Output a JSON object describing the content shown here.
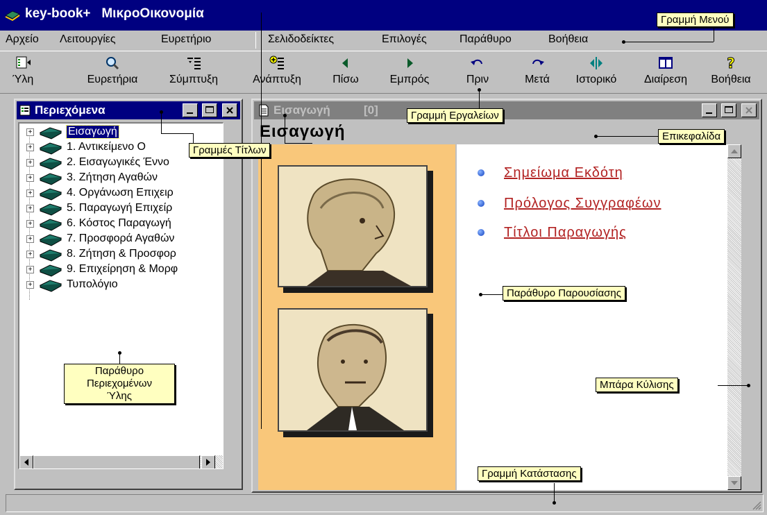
{
  "titlebar": {
    "app": "key-book+",
    "document": "ΜικροΟικονομία"
  },
  "menu": [
    "Αρχείο",
    "Λειτουργίες",
    "Ευρετήριο",
    "Σελιδοδείκτες",
    "Επιλογές",
    "Παράθυρο",
    "Βοήθεια"
  ],
  "toolbar": [
    {
      "label": "Ύλη",
      "icon": "topics-icon"
    },
    {
      "label": "Ευρετήρια",
      "icon": "search-icon"
    },
    {
      "label": "Σύμπτυξη",
      "icon": "collapse-icon"
    },
    {
      "label": "Ανάπτυξη",
      "icon": "expand-icon"
    },
    {
      "label": "Πίσω",
      "icon": "back-icon"
    },
    {
      "label": "Εμπρός",
      "icon": "forward-icon"
    },
    {
      "label": "Πριν",
      "icon": "undo-icon"
    },
    {
      "label": "Μετά",
      "icon": "redo-icon"
    },
    {
      "label": "Ιστορικό",
      "icon": "history-icon"
    },
    {
      "label": "Διαίρεση",
      "icon": "split-icon"
    },
    {
      "label": "Βοήθεια",
      "icon": "help-icon"
    }
  ],
  "contents_window": {
    "title": "Περιεχόμενα",
    "items": [
      "Εισαγωγή",
      "1. Αντικείμενο Ο",
      "2. Εισαγωγικές Έννο",
      "3. Ζήτηση Αγαθών",
      "4. Οργάνωση Επιχειρ",
      "5. Παραγωγή Επιχείρ",
      "6. Κόστος Παραγωγή",
      "7. Προσφορά Αγαθών",
      "8. Ζήτηση & Προσφορ",
      "9. Επιχείρηση & Μορφ",
      "Τυπολόγιο"
    ]
  },
  "presentation_window": {
    "title": "Εισαγωγή",
    "title_count": "[0]",
    "heading": "Εισαγωγή",
    "links": [
      "Σημείωμα Εκδότη",
      "Πρόλογος Συγγραφέων",
      "Τίτλοι Παραγωγής"
    ]
  },
  "callouts": {
    "menu_bar": "Γραμμή Μενού",
    "toolbar": "Γραμμή Εργαλείων",
    "title_bars": "Γραμμές Τίτλων",
    "heading": "Επικεφαλίδα",
    "presentation": "Παράθυρο Παρουσίασης",
    "contents_line1": "Παράθυρο",
    "contents_line2": "Περιεχομένων",
    "contents_line3": "Ύλης",
    "scrollbar": "Μπάρα Κύλισης",
    "statusbar": "Γραμμή Κατάστασης"
  },
  "colors": {
    "active_title": "#000080",
    "portrait_background": "#f9c77a",
    "link": "#b22222",
    "callout": "#ffffc0"
  }
}
